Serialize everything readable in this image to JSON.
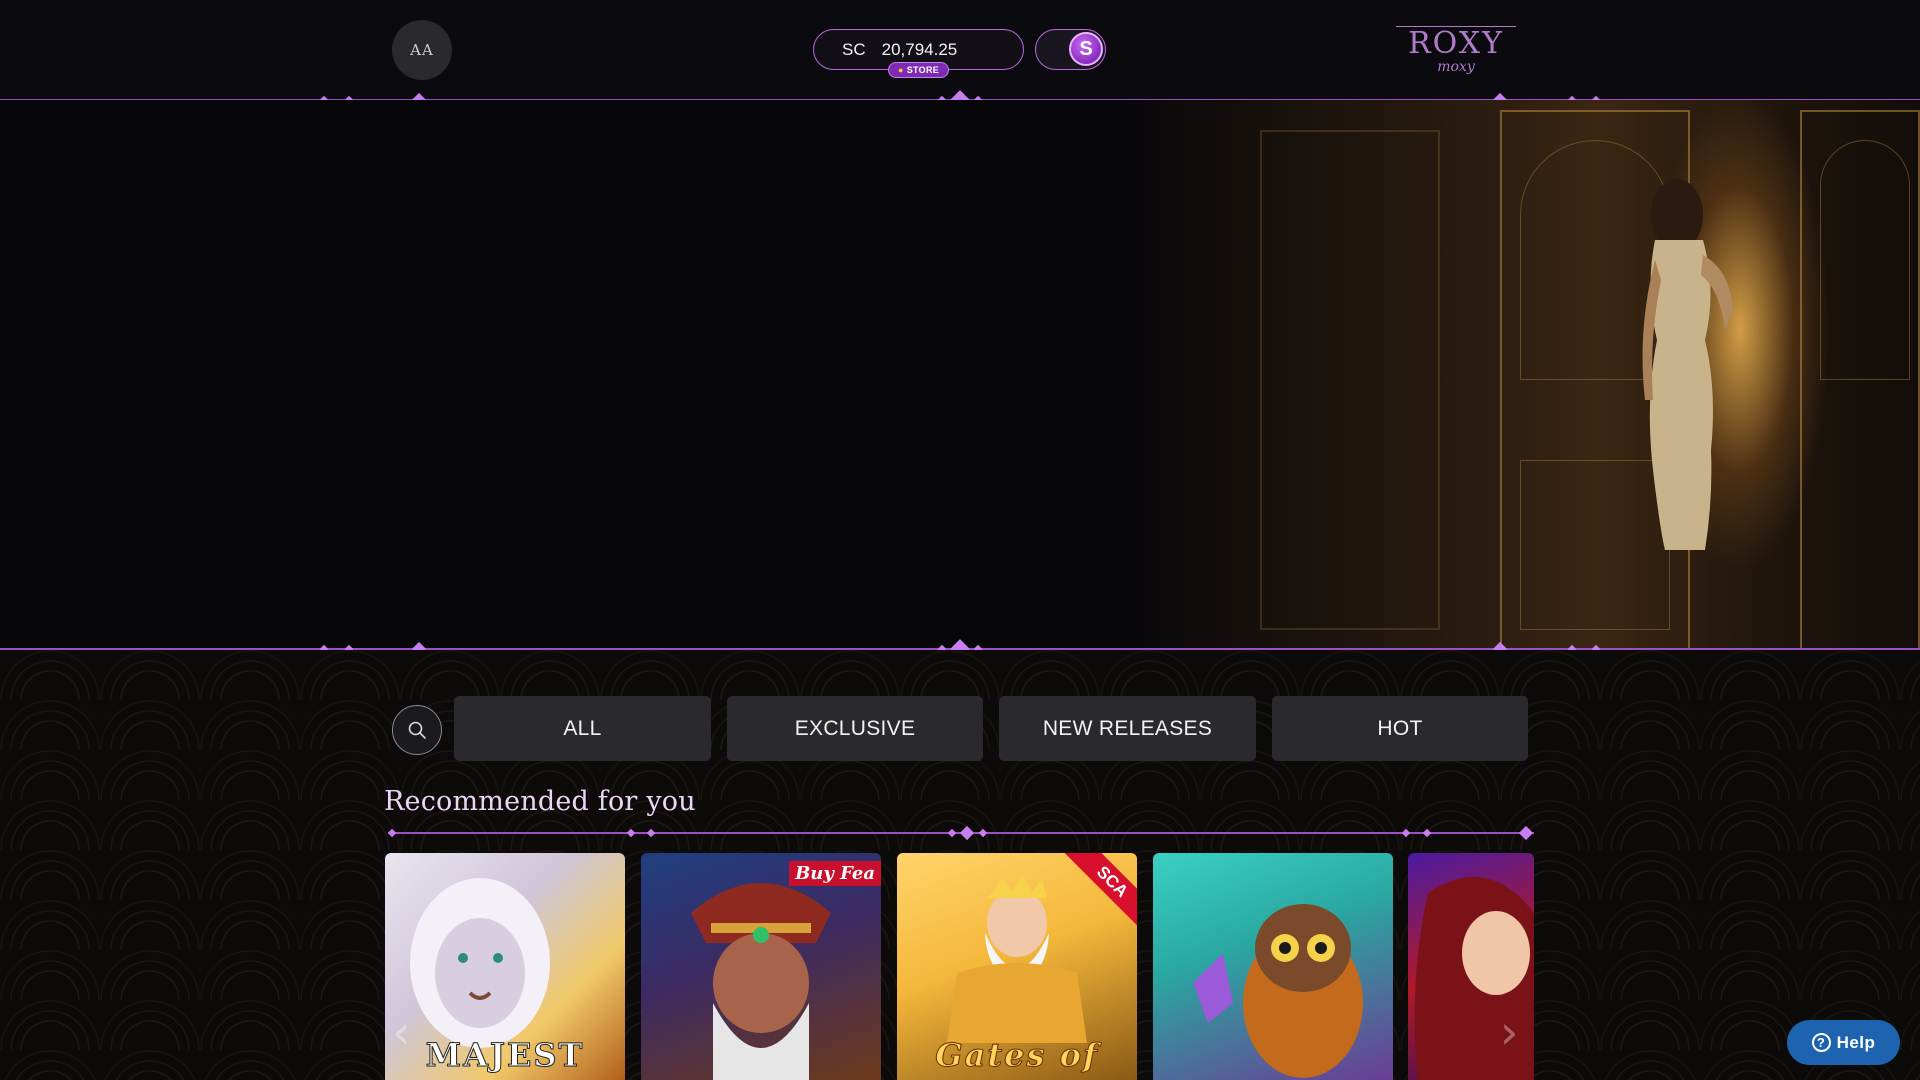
{
  "header": {
    "avatar_initials": "AA",
    "balance": {
      "currency": "SC",
      "amount": "20,794.25"
    },
    "store_label": "STORE",
    "toggle_icon_symbol": "S",
    "logo": {
      "main": "ROXY",
      "sub": "moxy"
    }
  },
  "hero": {
    "slide_count": 3,
    "active_slide": 1
  },
  "filters": {
    "search_icon": "search-icon",
    "tabs": [
      "ALL",
      "EXCLUSIVE",
      "NEW RELEASES",
      "HOT"
    ]
  },
  "recommended": {
    "title": "Recommended for you",
    "games": [
      {
        "visible_text": "MAJEST",
        "colors": [
          "#f1c96a",
          "#b25f1a"
        ]
      },
      {
        "visible_text": "Buy Fea",
        "colors": [
          "#1f3f80",
          "#6d3a1b"
        ]
      },
      {
        "visible_text": "Gates of",
        "badge": "SCA",
        "colors": [
          "#f4b73b",
          "#8a5a15"
        ]
      },
      {
        "visible_text": "",
        "colors": [
          "#2aa7a0",
          "#6b3c95"
        ]
      },
      {
        "visible_text": "",
        "colors": [
          "#b01a2a",
          "#3b0f55"
        ]
      }
    ]
  },
  "help": {
    "label": "Help"
  },
  "colors": {
    "accent": "#c77ef0",
    "line": "#9d4fc4",
    "button_bg": "#2a292d",
    "help_bg": "#1e63b0"
  }
}
